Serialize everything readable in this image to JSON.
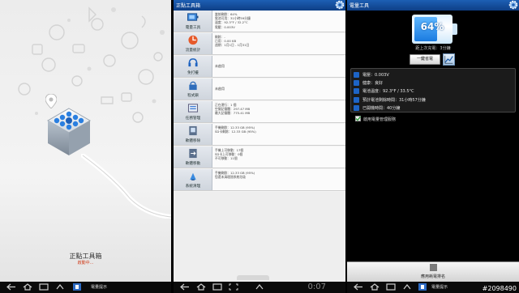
{
  "splash": {
    "title": "正點工具箱",
    "subtitle": "啟動中..."
  },
  "status_left": {
    "notification": "電量提示"
  },
  "toolbox": {
    "title": "正點工具箱",
    "rows": [
      {
        "label": "電量工具",
        "icon": "battery-icon",
        "lines": [
          "當前剩餘：64%",
          "電池可用：31小時59分鐘",
          "溫度：92.3°F / 32.2°C",
          "電壓：0.003V"
        ]
      },
      {
        "label": "流量統計",
        "icon": "traffic-icon",
        "lines": [
          "剩餘：-",
          "已用：0.00 KB",
          "週期：1月1日 - 1月31日"
        ]
      },
      {
        "label": "免打擾",
        "icon": "headset-icon",
        "lines": [
          "未啟用"
        ]
      },
      {
        "label": "程式鎖",
        "icon": "lock-icon",
        "lines": [
          "未啟用"
        ]
      },
      {
        "label": "任務管理",
        "icon": "task-icon",
        "lines": [
          "正在運行：1 個",
          "空閒記憶體：297.47 MB",
          "最大記憶體：775.41 MB"
        ]
      },
      {
        "label": "軟體移除",
        "icon": "uninstall-icon",
        "lines": [
          "手機剩餘：12.33 GB (95%)",
          "SD卡剩餘：12.33 GB (95%)"
        ]
      },
      {
        "label": "軟體移動",
        "icon": "move-icon",
        "lines": [
          "手機上可移動：17個",
          "SD卡上可移動：0個",
          "不可移動：11個"
        ]
      },
      {
        "label": "系統清理",
        "icon": "clean-icon",
        "lines": [
          "手機剩餘：12.33 GB (95%)",
          "您還未清理過系統垃圾"
        ]
      }
    ],
    "clock": "0:07"
  },
  "battery": {
    "title": "電量工具",
    "percent": "64%",
    "percent_value": 0.64,
    "since_charge": "距上次充電：3分鐘",
    "save_button": "一鍵省電",
    "stats": [
      {
        "icon": "voltage-icon",
        "text": "電壓：0.003V"
      },
      {
        "icon": "health-icon",
        "text": "健康：良好"
      },
      {
        "icon": "temperature-icon",
        "text": "電池溫度：92.3°F / 33.5°C"
      },
      {
        "icon": "clock-icon",
        "text": "預計電池剩餘時間：31小時57分鐘"
      },
      {
        "icon": "power-icon",
        "text": "已開機時間：40分鐘"
      }
    ],
    "checkbox_label": "啟用電量管理服務",
    "bottom_label": "應用耗電排名"
  },
  "status_right": {
    "notification": "電量提示"
  },
  "watermark": "#2098490",
  "colors": {
    "titlebar": "#1d5fb4",
    "accent_blue": "#1a7be0",
    "warning": "#d04020"
  }
}
